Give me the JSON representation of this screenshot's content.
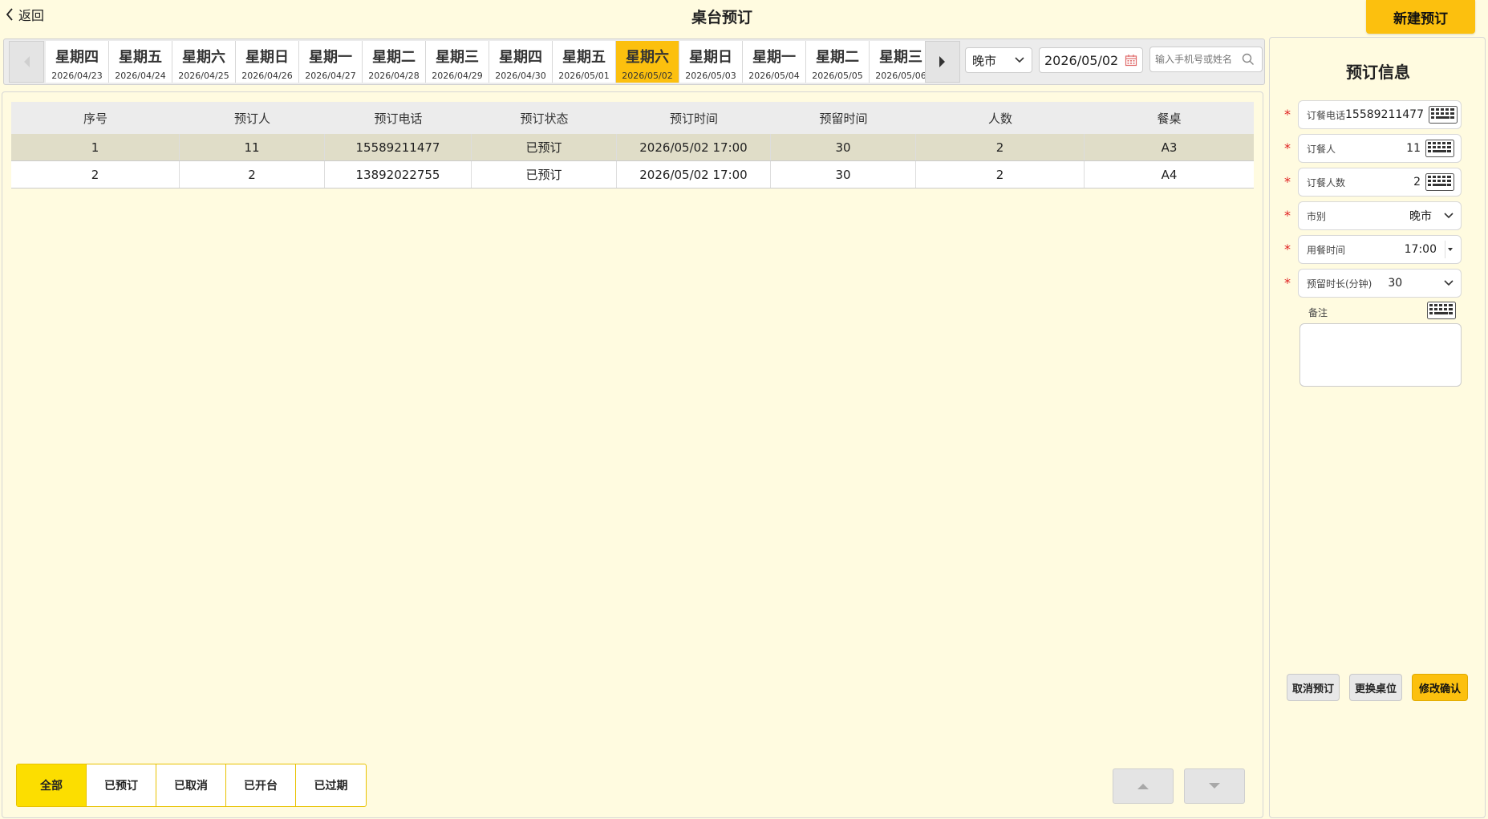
{
  "header": {
    "back_label": "返回",
    "title": "桌台预订",
    "new_button": "新建预订"
  },
  "date_strip": {
    "days": [
      {
        "weekday": "星期四",
        "date": "2026/04/23"
      },
      {
        "weekday": "星期五",
        "date": "2026/04/24"
      },
      {
        "weekday": "星期六",
        "date": "2026/04/25"
      },
      {
        "weekday": "星期日",
        "date": "2026/04/26"
      },
      {
        "weekday": "星期一",
        "date": "2026/04/27"
      },
      {
        "weekday": "星期二",
        "date": "2026/04/28"
      },
      {
        "weekday": "星期三",
        "date": "2026/04/29"
      },
      {
        "weekday": "星期四",
        "date": "2026/04/30"
      },
      {
        "weekday": "星期五",
        "date": "2026/05/01"
      },
      {
        "weekday": "星期六",
        "date": "2026/05/02"
      },
      {
        "weekday": "星期日",
        "date": "2026/05/03"
      },
      {
        "weekday": "星期一",
        "date": "2026/05/04"
      },
      {
        "weekday": "星期二",
        "date": "2026/05/05"
      },
      {
        "weekday": "星期三",
        "date": "2026/05/06"
      }
    ],
    "selected_index": 9,
    "meal_select": "晚市",
    "date_value": "2026/05/02",
    "search_placeholder": "输入手机号或姓名"
  },
  "table": {
    "columns": [
      "序号",
      "预订人",
      "预订电话",
      "预订状态",
      "预订时间",
      "预留时间",
      "人数",
      "餐桌"
    ],
    "rows": [
      [
        "1",
        "11",
        "15589211477",
        "已预订",
        "2026/05/02 17:00",
        "30",
        "2",
        "A3"
      ],
      [
        "2",
        "2",
        "13892022755",
        "已预订",
        "2026/05/02 17:00",
        "30",
        "2",
        "A4"
      ]
    ],
    "selected_row": 0
  },
  "filters": {
    "items": [
      "全部",
      "已预订",
      "已取消",
      "已开台",
      "已过期"
    ],
    "active_index": 0
  },
  "side": {
    "title": "预订信息",
    "phone": {
      "label": "订餐电话",
      "value": "15589211477"
    },
    "booker": {
      "label": "订餐人",
      "value": "11"
    },
    "guests": {
      "label": "订餐人数",
      "value": "2"
    },
    "meal": {
      "label": "市别",
      "value": "晚市"
    },
    "dining_time": {
      "label": "用餐时间",
      "value": "17:00"
    },
    "hold": {
      "label": "预留时长(分钟)",
      "value": "30"
    },
    "note_label": "备注",
    "note_value": "",
    "buttons": {
      "cancel": "取消预订",
      "change_table": "更换桌位",
      "confirm": "修改确认"
    }
  },
  "colors": {
    "accent": "#fcc00e",
    "background": "#fffbe0",
    "required": "#e02020",
    "selected_row": "#e0ddc8"
  }
}
